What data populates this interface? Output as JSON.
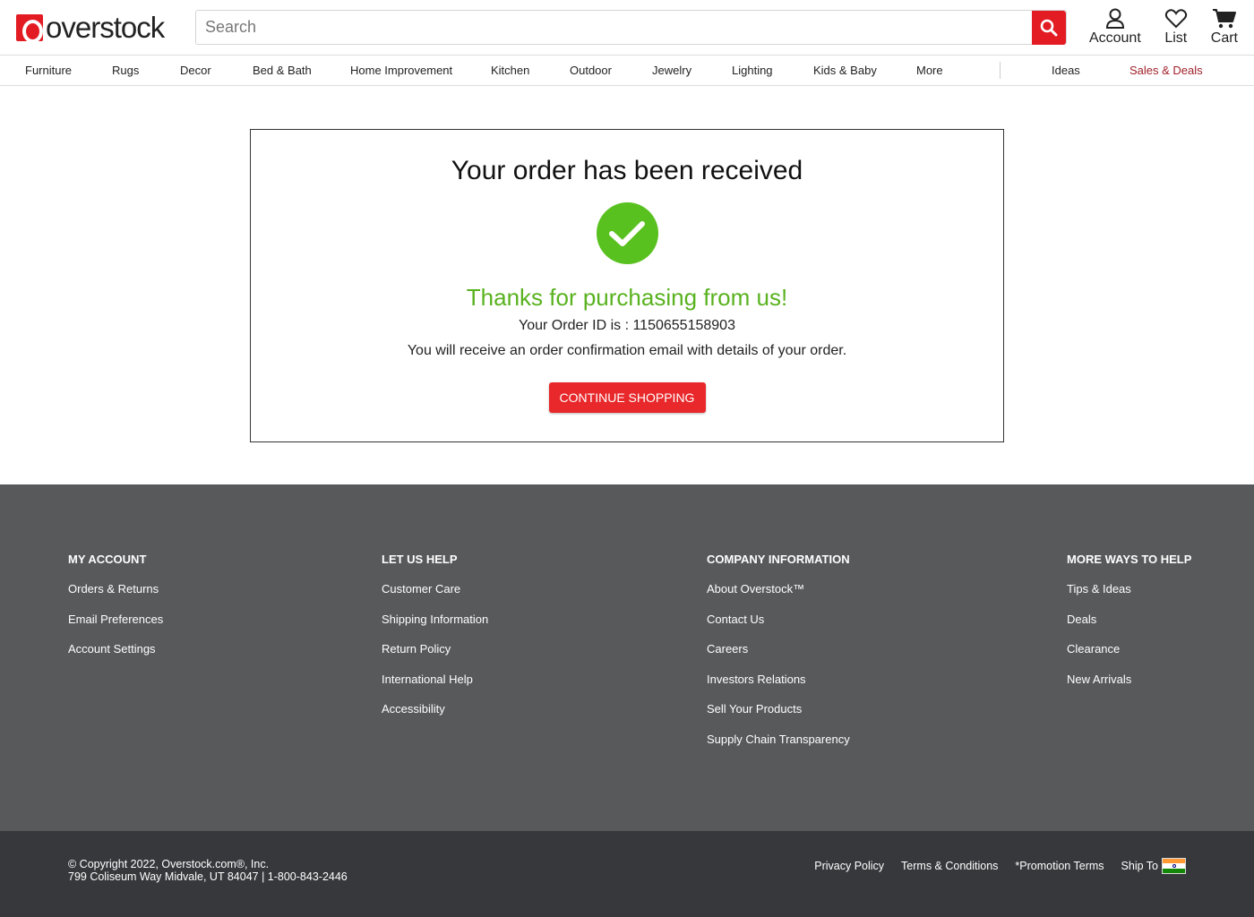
{
  "header": {
    "logo_text": "overstock",
    "search_placeholder": "Search",
    "account_label": "Account",
    "list_label": "List",
    "cart_label": "Cart"
  },
  "nav": {
    "items": [
      "Furniture",
      "Rugs",
      "Decor",
      "Bed & Bath",
      "Home Improvement",
      "Kitchen",
      "Outdoor",
      "Jewelry",
      "Lighting",
      "Kids & Baby",
      "More"
    ],
    "ideas": "Ideas",
    "deals": "Sales & Deals"
  },
  "order": {
    "title": "Your order has been received",
    "thanks": "Thanks for purchasing from us!",
    "order_id_text": "Your Order ID is : 1150655158903",
    "confirmation": "You will receive an order confirmation email with details of your order.",
    "continue_label": "CONTINUE SHOPPING"
  },
  "footer": {
    "columns": [
      {
        "heading": "MY ACCOUNT",
        "links": [
          "Orders & Returns",
          "Email Preferences",
          "Account Settings"
        ]
      },
      {
        "heading": "LET US HELP",
        "links": [
          "Customer Care",
          "Shipping Information",
          "Return Policy",
          "International Help",
          "Accessibility"
        ]
      },
      {
        "heading": "COMPANY INFORMATION",
        "links": [
          "About Overstock™",
          "Contact Us",
          "Careers",
          "Investors Relations",
          "Sell Your Products",
          "Supply Chain Transparency"
        ]
      },
      {
        "heading": "MORE WAYS TO HELP",
        "links": [
          "Tips & Ideas",
          "Deals",
          "Clearance",
          "New Arrivals"
        ]
      }
    ],
    "copyright": "© Copyright 2022, Overstock.com®, Inc.",
    "address": "799 Coliseum Way Midvale, UT 84047 | 1-800-843-2446",
    "bottom_links": [
      "Privacy Policy",
      "Terms & Conditions",
      "*Promotion Terms"
    ],
    "ship_to": "Ship To"
  },
  "colors": {
    "brand_red": "#e31b23",
    "success_green": "#59c11f",
    "footer_bg": "#58595b",
    "bottom_bg": "#37383c"
  }
}
